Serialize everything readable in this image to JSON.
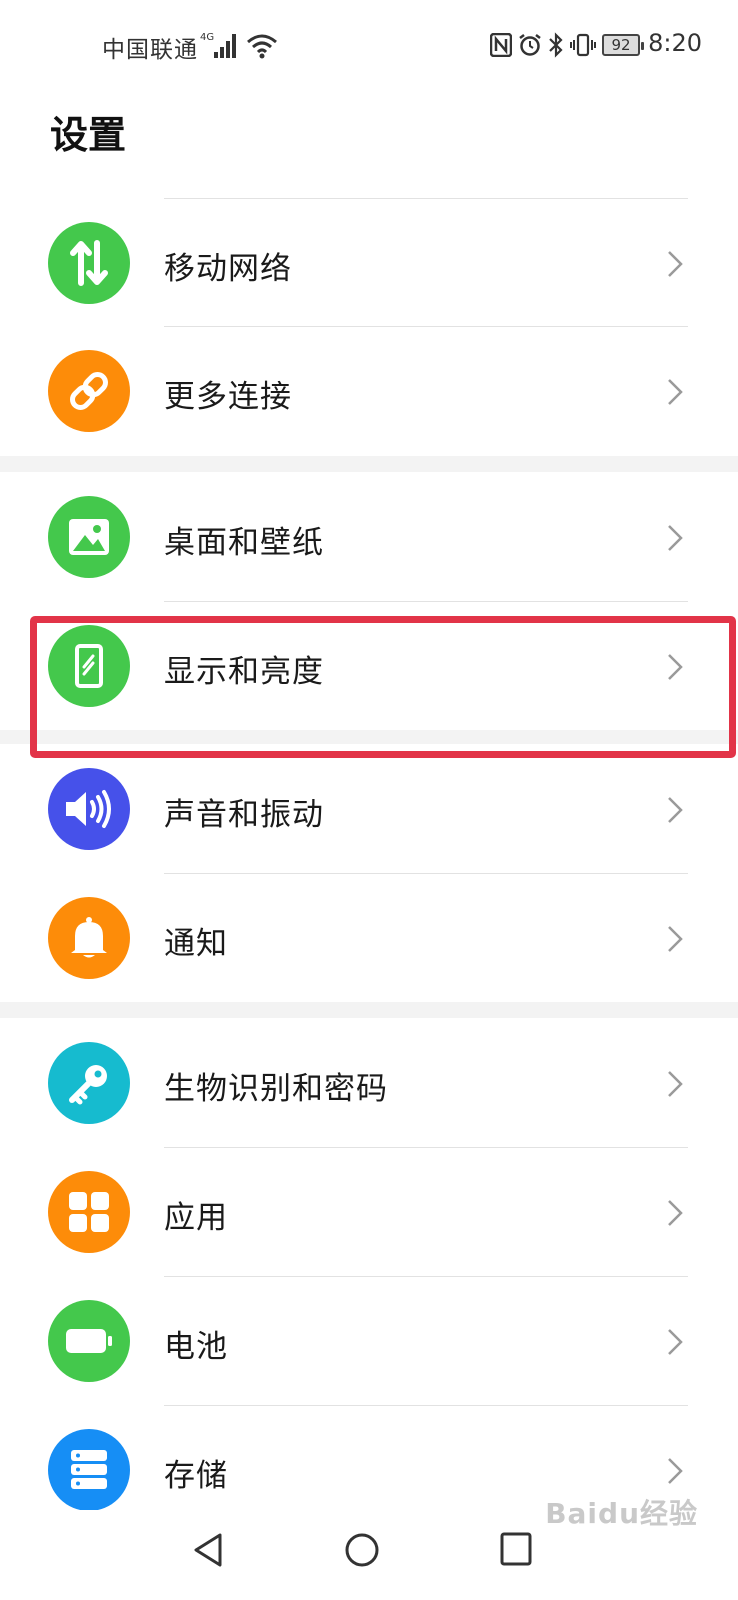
{
  "status_bar": {
    "carrier": "中国联通",
    "network": "4G",
    "battery": "92",
    "time": "8:20"
  },
  "page_title": "设置",
  "colors": {
    "green": "#44c84c",
    "orange": "#fd8c09",
    "blue": "#4651ea",
    "teal": "#16bbcf",
    "storage_blue": "#168ef5",
    "highlight": "#e23448"
  },
  "items": [
    {
      "label": "移动网络",
      "icon": "mobile-data-icon"
    },
    {
      "label": "更多连接",
      "icon": "link-icon"
    },
    {
      "label": "桌面和壁纸",
      "icon": "wallpaper-icon"
    },
    {
      "label": "显示和亮度",
      "icon": "display-icon"
    },
    {
      "label": "声音和振动",
      "icon": "sound-icon"
    },
    {
      "label": "通知",
      "icon": "bell-icon"
    },
    {
      "label": "生物识别和密码",
      "icon": "key-icon"
    },
    {
      "label": "应用",
      "icon": "apps-icon"
    },
    {
      "label": "电池",
      "icon": "battery-icon"
    },
    {
      "label": "存储",
      "icon": "storage-icon"
    }
  ],
  "watermark": "Baidu经验"
}
